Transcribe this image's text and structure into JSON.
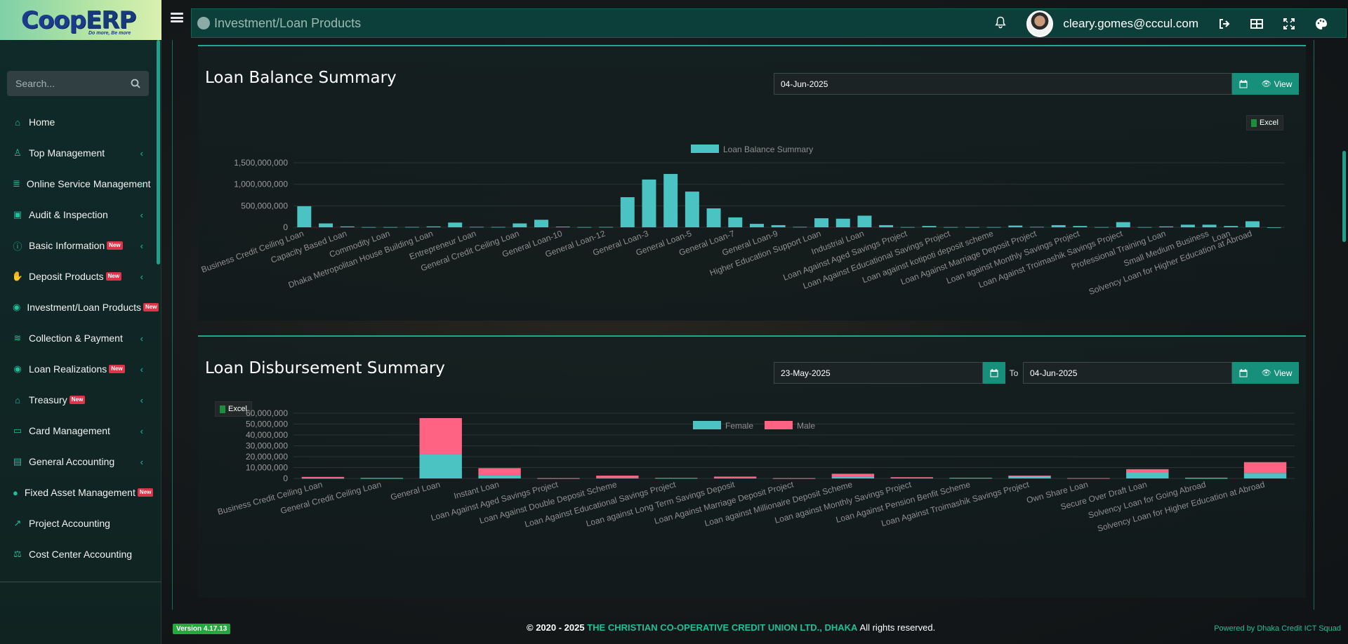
{
  "brand": {
    "logo_main": "Coop",
    "logo_erp": "ERP",
    "logo_tagline": "Do more, Be more"
  },
  "search": {
    "placeholder": "Search..."
  },
  "sidebar": {
    "items": [
      {
        "label": "Home",
        "icon": "home-icon",
        "badge": "",
        "chevron": false
      },
      {
        "label": "Top Management",
        "icon": "user-tie-icon",
        "badge": "",
        "chevron": true
      },
      {
        "label": "Online Service Management",
        "icon": "database-icon",
        "badge": "",
        "chevron": true
      },
      {
        "label": "Audit & Inspection",
        "icon": "clipboard-check-icon",
        "badge": "",
        "chevron": true
      },
      {
        "label": "Basic Information",
        "icon": "info-icon",
        "badge": "New",
        "chevron": true
      },
      {
        "label": "Deposit Products",
        "icon": "hand-coin-icon",
        "badge": "New",
        "chevron": true
      },
      {
        "label": "Investment/Loan Products",
        "icon": "money-icon",
        "badge": "New",
        "chevron": false
      },
      {
        "label": "Collection & Payment",
        "icon": "coins-icon",
        "badge": "",
        "chevron": true
      },
      {
        "label": "Loan Realizations",
        "icon": "money-icon",
        "badge": "New",
        "chevron": true
      },
      {
        "label": "Treasury",
        "icon": "treasury-icon",
        "badge": "New",
        "chevron": true
      },
      {
        "label": "Card Management",
        "icon": "card-icon",
        "badge": "",
        "chevron": true
      },
      {
        "label": "General Accounting",
        "icon": "book-icon",
        "badge": "",
        "chevron": true
      },
      {
        "label": "Fixed Asset Management",
        "icon": "piggy-icon",
        "badge": "New",
        "chevron": false
      },
      {
        "label": "Project Accounting",
        "icon": "chart-line-icon",
        "badge": "",
        "chevron": false
      },
      {
        "label": "Cost Center Accounting",
        "icon": "scale-icon",
        "badge": "",
        "chevron": false
      }
    ]
  },
  "header": {
    "title": "Investment/Loan Products",
    "user_email": "cleary.gomes@cccul.com"
  },
  "panel1": {
    "title": "Loan Balance Summary",
    "date": "04-Jun-2025",
    "view_label": "View",
    "excel_label": "Excel"
  },
  "panel2": {
    "title": "Loan Disbursement Summary",
    "from_date": "23-May-2025",
    "to_label": "To",
    "to_date": "04-Jun-2025",
    "view_label": "View",
    "excel_label": "Excel"
  },
  "footer": {
    "version": "Version 4.17.13",
    "copyright_prefix": "© 2020 - 2025",
    "org": "THE CHRISTIAN CO-OPERATIVE CREDIT UNION LTD., DHAKA",
    "rights": "All rights reserved.",
    "powered": "Powered by Dhaka Credit ICT Squad"
  },
  "colors": {
    "accent": "#16907a",
    "bar_teal": "#4cc3c3",
    "bar_pink": "#ff6384",
    "header_bg": "#0d3f3a"
  },
  "chart_data": [
    {
      "type": "bar",
      "title": "",
      "legend": [
        "Loan Balance Summary"
      ],
      "legend_position": "top",
      "ylim": [
        0,
        1500000000
      ],
      "yticks": [
        "0",
        "500,000,000",
        "1,000,000,000",
        "1,500,000,000"
      ],
      "categories": [
        "Business Credit Ceiling Loan",
        "",
        "Capacity Based Loan",
        "",
        "Commodity Loan",
        "",
        "Dhaka Metropolitan House Building Loan",
        "",
        "Entrepreneur Loan",
        "",
        "General Credit Ceiling Loan",
        "",
        "General Loan-10",
        "",
        "General Loan-12",
        "",
        "General Loan-3",
        "",
        "General Loan-5",
        "",
        "General Loan-7",
        "",
        "General Loan-9",
        "",
        "Higher Education Support Loan",
        "",
        "Industrial Loan",
        "",
        "Loan Against Aged Savings Project",
        "",
        "Loan Against Educational Savings Project",
        "",
        "Loan against kotipoti deposit scheme",
        "",
        "Loan Against Marriage Deposit Project",
        "",
        "Loan against Monthly Savings Project",
        "",
        "Loan Against Troimashik Savings Project",
        "",
        "Professional Training Loan",
        "",
        "Small Medium Business",
        "Loan",
        "Solvency Loan for Higher Education at Abroad",
        ""
      ],
      "series": [
        {
          "name": "Loan Balance Summary",
          "values": [
            490000000,
            90000000,
            20000000,
            5000000,
            5000000,
            8000000,
            20000000,
            110000000,
            10000000,
            8000000,
            90000000,
            175000000,
            15000000,
            5000000,
            8000000,
            700000000,
            1110000000,
            1240000000,
            830000000,
            440000000,
            230000000,
            80000000,
            50000000,
            10000000,
            210000000,
            200000000,
            270000000,
            50000000,
            5000000,
            30000000,
            5000000,
            5000000,
            5000000,
            40000000,
            10000000,
            50000000,
            30000000,
            5000000,
            120000000,
            5000000,
            20000000,
            60000000,
            60000000,
            30000000,
            140000000
          ]
        }
      ]
    },
    {
      "type": "bar",
      "title": "",
      "stacked": true,
      "legend": [
        "Female",
        "Male"
      ],
      "legend_position": "top",
      "ylim": [
        0,
        60000000
      ],
      "yticks": [
        "0",
        "10,000,000",
        "20,000,000",
        "30,000,000",
        "40,000,000",
        "50,000,000",
        "60,000,000"
      ],
      "categories": [
        "Business Credit Ceiling Loan",
        "General Credit Ceiling Loan",
        "General Loan",
        "Instant Loan",
        "Loan Against Aged Savings Project",
        "Loan Against Double Deposit Scheme",
        "Loan Against Educational Savings Project",
        "Loan against Long Term Savings Deposit",
        "Loan Against Marriage Deposit Project",
        "Loan against Millionaire Deposit Scheme",
        "Loan against Monthly Savings Project",
        "Loan Against Pension Benfit Scheme",
        "Loan Against Troimashik Savings Project",
        "Own Share Loan",
        "Secure Over Draft Loan",
        "Solvency Loan for Going Abroad",
        "Solvency Loan for Higher Education at Abroad"
      ],
      "series": [
        {
          "name": "Female",
          "values": [
            300000,
            200000,
            22500000,
            3000000,
            100000,
            800000,
            300000,
            700000,
            100000,
            1800000,
            800000,
            400000,
            2500000,
            200000,
            5500000,
            200000,
            5000000
          ]
        },
        {
          "name": "Male",
          "values": [
            1100000,
            300000,
            33000000,
            6500000,
            200000,
            1800000,
            200000,
            1000000,
            200000,
            2500000,
            300000,
            200000,
            100000,
            100000,
            3000000,
            500000,
            10000000
          ]
        }
      ]
    }
  ]
}
